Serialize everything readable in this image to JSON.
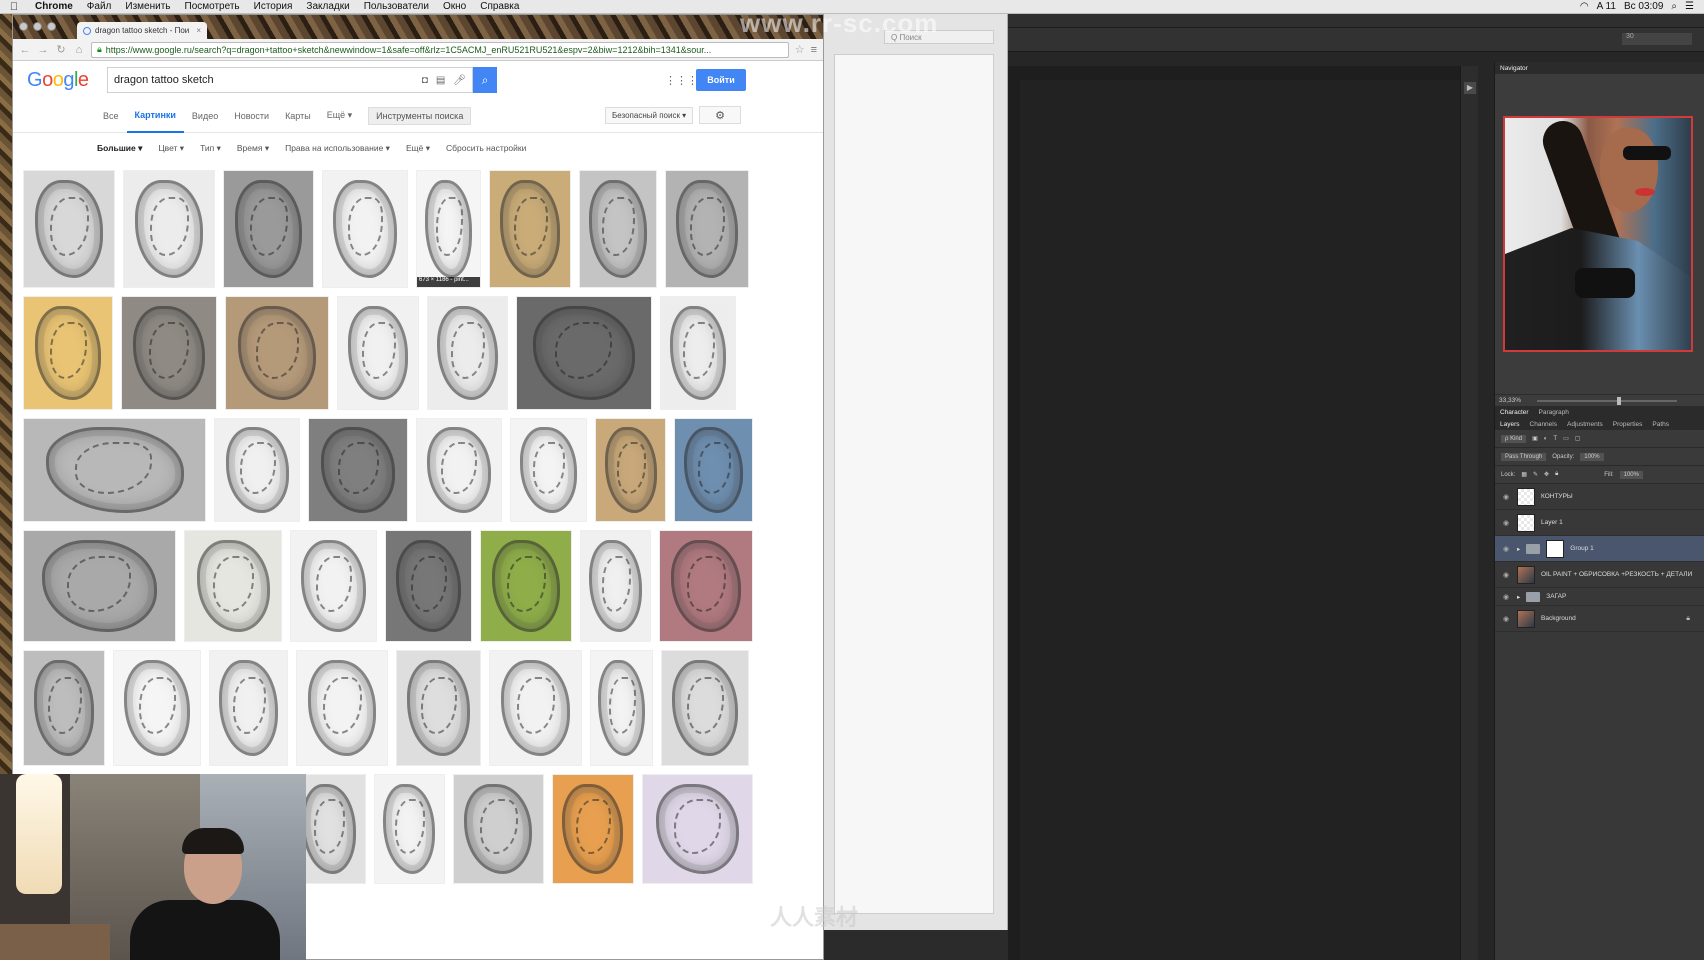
{
  "menubar": {
    "apple": "",
    "items": [
      "Chrome",
      "Файл",
      "Изменить",
      "Посмотреть",
      "История",
      "Закладки",
      "Пользователи",
      "Окно",
      "Справка"
    ],
    "status": [
      "A 11",
      "Вс 03:09"
    ]
  },
  "watermark": {
    "top": "www.rr-sc.com",
    "bottom": "人人素材"
  },
  "browser": {
    "tab_title": "dragon tattoo sketch - Пои",
    "url": "https://www.google.ru/search?q=dragon+tattoo+sketch&newwindow=1&safe=off&rlz=1C5ACMJ_enRU521RU521&espv=2&biw=1212&bih=1341&sour..."
  },
  "google": {
    "logo": [
      "G",
      "o",
      "o",
      "g",
      "l",
      "e"
    ],
    "query": "dragon tattoo sketch",
    "signin": "Войти",
    "tabs": [
      "Все",
      "Картинки",
      "Видео",
      "Новости",
      "Карты",
      "Ещё ▾"
    ],
    "active_tab": "Картинки",
    "tools": "Инструменты поиска",
    "safe_search": "Безопасный поиск ▾",
    "filters": [
      "Большие ▾",
      "Цвет ▾",
      "Тип ▾",
      "Время ▾",
      "Права на использование ▾",
      "Ещё ▾",
      "Сбросить настройки"
    ],
    "hover_tip": "673 × 1186 - pint..."
  },
  "image_rows": [
    {
      "thumbs": [
        {
          "w": 0.126,
          "tone": "#d8d8d8"
        },
        {
          "w": 0.126,
          "tone": "#ececec"
        },
        {
          "w": 0.124,
          "tone": "#9a9a9a"
        },
        {
          "w": 0.118,
          "tone": "#f2f2f2"
        },
        {
          "w": 0.089,
          "tone": "#f5f5f5",
          "tip": true
        },
        {
          "w": 0.113,
          "tone": "#c9ac78"
        },
        {
          "w": 0.107,
          "tone": "#c4c4c4"
        },
        {
          "w": 0.115,
          "tone": "#b3b3b3"
        }
      ]
    },
    {
      "thumbs": [
        {
          "w": 0.123,
          "tone": "#e9c474"
        },
        {
          "w": 0.131,
          "tone": "#8f8a84"
        },
        {
          "w": 0.142,
          "tone": "#b59a7a"
        },
        {
          "w": 0.113,
          "tone": "#f1f1f1"
        },
        {
          "w": 0.111,
          "tone": "#ececec"
        },
        {
          "w": 0.186,
          "tone": "#6a6a6a"
        },
        {
          "w": 0.104,
          "tone": "#ededed"
        }
      ]
    },
    {
      "thumbs": [
        {
          "w": 0.252,
          "tone": "#b8b8b8"
        },
        {
          "w": 0.118,
          "tone": "#f0f0f0"
        },
        {
          "w": 0.137,
          "tone": "#7f7f7f"
        },
        {
          "w": 0.118,
          "tone": "#f2f2f2"
        },
        {
          "w": 0.107,
          "tone": "#f4f4f4"
        },
        {
          "w": 0.097,
          "tone": "#c9a97a"
        },
        {
          "w": 0.108,
          "tone": "#6f8fb0"
        }
      ]
    },
    {
      "thumbs": [
        {
          "w": 0.213,
          "tone": "#a9a9a9"
        },
        {
          "w": 0.135,
          "tone": "#e6e6e0"
        },
        {
          "w": 0.121,
          "tone": "#f2f2f2"
        },
        {
          "w": 0.121,
          "tone": "#777777"
        },
        {
          "w": 0.127,
          "tone": "#8fae4a"
        },
        {
          "w": 0.098,
          "tone": "#f0f0f0"
        },
        {
          "w": 0.13,
          "tone": "#b07a80"
        }
      ]
    },
    {
      "thumbs": [
        {
          "w": 0.112,
          "tone": "#bdbdbd"
        },
        {
          "w": 0.12,
          "tone": "#f5f5f5"
        },
        {
          "w": 0.108,
          "tone": "#f1f1f1"
        },
        {
          "w": 0.126,
          "tone": "#f3f3f3"
        },
        {
          "w": 0.117,
          "tone": "#dedede"
        },
        {
          "w": 0.128,
          "tone": "#f2f2f2"
        },
        {
          "w": 0.086,
          "tone": "#f4f4f4"
        },
        {
          "w": 0.12,
          "tone": "#dcdcdc"
        }
      ]
    },
    {
      "thumbs": [
        {
          "w": 0.374,
          "tone": "#3a3530"
        },
        {
          "w": 0.106,
          "tone": "#e1e1e1"
        },
        {
          "w": 0.101,
          "tone": "#f3f3f3"
        },
        {
          "w": 0.13,
          "tone": "#cfcfcf"
        },
        {
          "w": 0.118,
          "tone": "#e8a050"
        },
        {
          "w": 0.159,
          "tone": "#e0d8e8"
        }
      ]
    }
  ],
  "midwindow": {
    "search_placeholder": "Q Поиск"
  },
  "photoshop": {
    "zoom_box": "30",
    "navigator_tab": "Navigator",
    "zoom": "33,33%",
    "char_tabs": [
      "Character",
      "Paragraph"
    ],
    "layer_tabs": [
      "Layers",
      "Channels",
      "Adjustments",
      "Properties",
      "Paths"
    ],
    "kind": "ρ Kind",
    "blend_mode": "Pass Through",
    "opacity_label": "Opacity:",
    "opacity": "100%",
    "lock_label": "Lock:",
    "fill_label": "Fill:",
    "fill": "100%",
    "layers": [
      {
        "name": "КОНТУРЫ",
        "type": "layer",
        "thumb": "trans"
      },
      {
        "name": "Layer 1",
        "type": "layer",
        "thumb": "trans"
      },
      {
        "name": "Group 1",
        "type": "group",
        "selected": true
      },
      {
        "name": "OIL PAINT + ОБРИСОВКА +РЕЗКОСТЬ + ДЕТАЛИ",
        "type": "layer",
        "thumb": "photo"
      },
      {
        "name": "ЗАГАР",
        "type": "group"
      },
      {
        "name": "Background",
        "type": "layer",
        "thumb": "photo",
        "locked": true
      }
    ]
  }
}
